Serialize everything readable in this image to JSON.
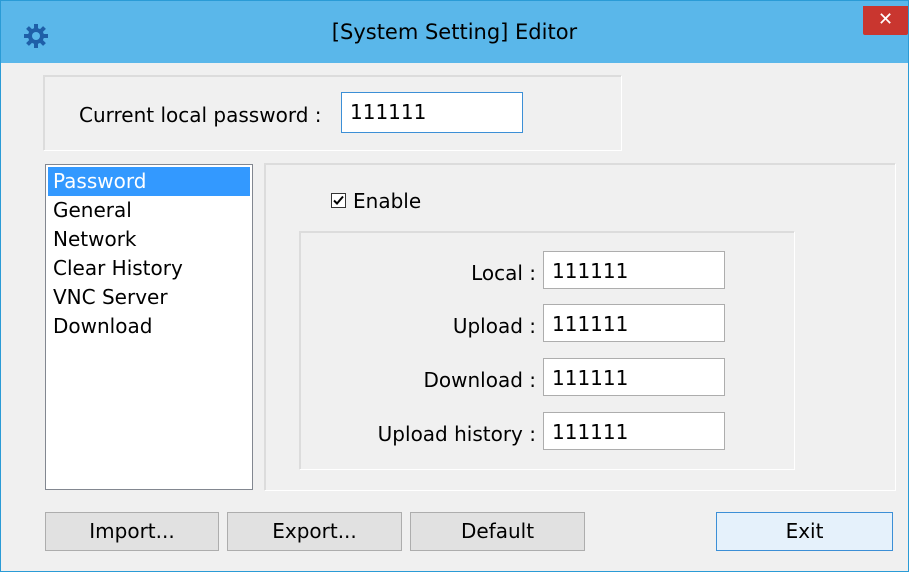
{
  "window": {
    "title": "[System Setting] Editor",
    "icon": "gear-icon",
    "close_symbol": "✕"
  },
  "current_password": {
    "label": "Current local password :",
    "value": "111111"
  },
  "nav_list": {
    "items": [
      "Password",
      "General",
      "Network",
      "Clear History",
      "VNC Server",
      "Download"
    ],
    "selected": "Password"
  },
  "password_panel": {
    "enable_label": "Enable",
    "enable_checked": true,
    "fields": [
      {
        "label": "Local :",
        "value": "111111"
      },
      {
        "label": "Upload :",
        "value": "111111"
      },
      {
        "label": "Download :",
        "value": "111111"
      },
      {
        "label": "Upload history :",
        "value": "111111"
      }
    ]
  },
  "buttons": {
    "import": "Import...",
    "export": "Export...",
    "default": "Default",
    "exit": "Exit"
  },
  "colors": {
    "titlebar": "#5ab7ea",
    "close": "#c9362f",
    "selection": "#3399ff",
    "accent_border": "#3c8fd6"
  }
}
